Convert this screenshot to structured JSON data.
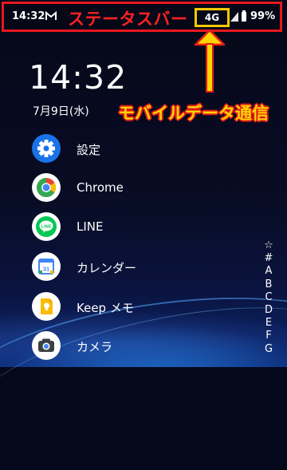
{
  "status_bar": {
    "time": "14:32",
    "label": "ステータスバー",
    "network": "4G",
    "battery_percent": "99%",
    "icons": [
      "gmail-icon",
      "signal-icon",
      "battery-icon"
    ]
  },
  "annotation": {
    "label": "モバイルデータ通信",
    "highlight_color": "#f3c900",
    "border_color": "#e8181d"
  },
  "home": {
    "clock": "14:32",
    "date": "7月9日(水)"
  },
  "apps": [
    {
      "label": "設定",
      "icon": "settings-icon"
    },
    {
      "label": "Chrome",
      "icon": "chrome-icon"
    },
    {
      "label": "LINE",
      "icon": "line-icon"
    },
    {
      "label": "カレンダー",
      "icon": "calendar-icon"
    },
    {
      "label": "Keep メモ",
      "icon": "keep-icon"
    },
    {
      "label": "カメラ",
      "icon": "camera-icon"
    }
  ],
  "alphabet_index": [
    "☆",
    "#",
    "A",
    "B",
    "C",
    "D",
    "E",
    "F",
    "G"
  ]
}
